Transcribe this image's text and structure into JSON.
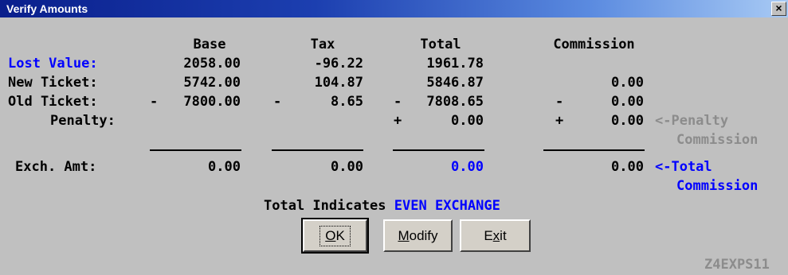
{
  "window": {
    "title": "Verify Amounts",
    "close_label": "×"
  },
  "headers": {
    "base": "Base",
    "tax": "Tax",
    "total": "Total",
    "commission": "Commission"
  },
  "rows": [
    {
      "label": "Lost Value:",
      "base": "2058.00",
      "tax": "-96.22",
      "total": "1961.78",
      "commission": ""
    },
    {
      "label": "New Ticket:",
      "base": "5742.00",
      "tax": "104.87",
      "total": "5846.87",
      "commission": "0.00"
    },
    {
      "label": "Old Ticket:",
      "base": "7800.00",
      "base_sign": "-",
      "tax": "8.65",
      "tax_sign": "-",
      "total": "7808.65",
      "total_sign": "-",
      "commission": "0.00",
      "commission_sign": "-"
    },
    {
      "label": "Penalty:",
      "total": "0.00",
      "total_sign": "+",
      "commission": "0.00",
      "commission_sign": "+"
    }
  ],
  "penalty_note": {
    "line1": "<-Penalty",
    "line2": "Commission"
  },
  "exchange": {
    "label": "Exch. Amt:",
    "base": "0.00",
    "tax": "0.00",
    "total": "0.00",
    "commission": "0.00"
  },
  "total_note": {
    "line1": "<-Total",
    "line2": "Commission"
  },
  "status": {
    "prefix": "Total Indicates",
    "value": "EVEN EXCHANGE"
  },
  "buttons": {
    "ok": {
      "mnemonic": "O",
      "rest": "K"
    },
    "modify": {
      "mnemonic": "M",
      "rest": "odify"
    },
    "exit": {
      "pre": "E",
      "mnemonic": "x",
      "rest": "it"
    }
  },
  "screen_code": "Z4EXPS11",
  "colors": {
    "label_highlight": "#0000ff",
    "note_inactive": "#8c8c8c",
    "titlebar_start": "#0a1f8c"
  }
}
